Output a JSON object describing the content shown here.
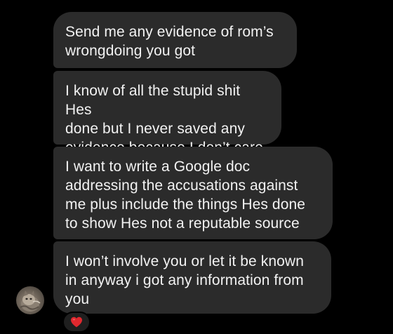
{
  "messages": [
    {
      "text": "Send me any evidence of rom’s\nwrongdoing you got"
    },
    {
      "text": "I know of all the stupid shit Hes\ndone but I never saved any\nevidence because I don’t care"
    },
    {
      "text": "I want to write a Google doc\naddressing the accusations against\nme plus include the things Hes done\nto show Hes not a reputable source"
    },
    {
      "text": "I won’t involve you or let it be known\nin anyway i got any information from\nyou"
    }
  ],
  "sender_avatar": {
    "icon": "cat-avatar-icon"
  },
  "reaction": {
    "icon": "red-heart-icon",
    "color": "#e0282e"
  },
  "colors": {
    "background": "#000000",
    "bubble": "#2b2b2b",
    "text": "#f2f2f2"
  }
}
